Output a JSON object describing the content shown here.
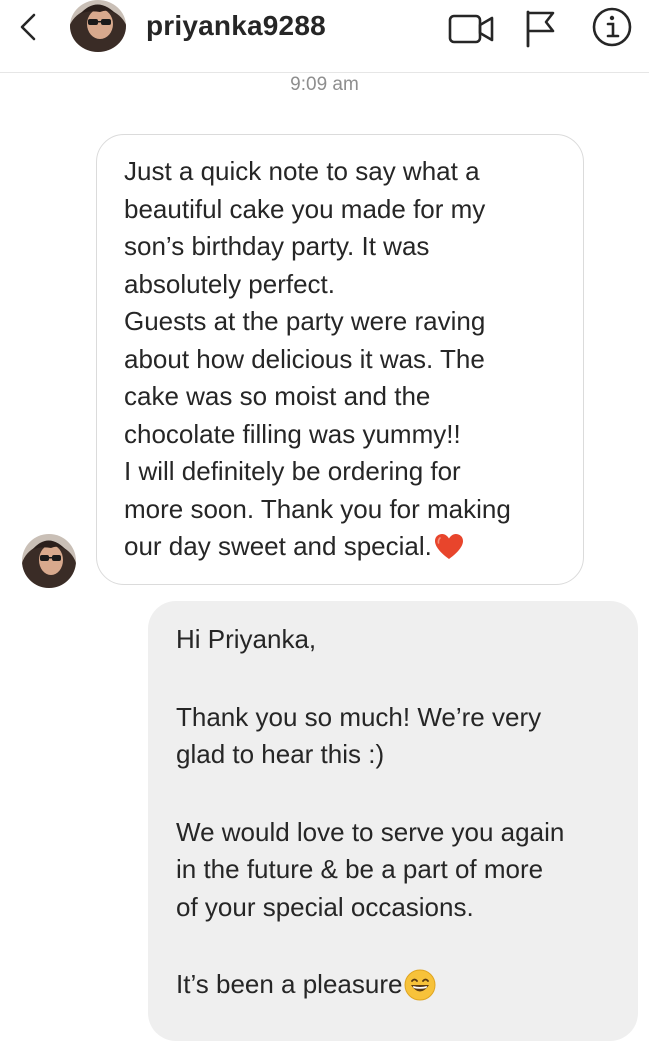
{
  "header": {
    "username": "priyanka9288",
    "icons": [
      "back-chevron-icon",
      "video-call-icon",
      "flag-report-icon",
      "info-icon"
    ]
  },
  "thread": {
    "timestamp": "9:09 am",
    "incoming": {
      "lines": [
        "Just a quick note to say what a\nbeautiful cake you made for my\nson’s birthday party. It was\nabsolutely perfect.",
        "Guests at the party were raving\nabout how delicious it was. The\ncake was so moist and the\nchocolate filling was yummy!!",
        "I will definitely be ordering for\nmore soon. Thank you for making\nour day sweet and special."
      ],
      "end_emoji": "red-heart"
    },
    "outgoing": {
      "paragraphs": [
        "Hi Priyanka,",
        "Thank you so much! We’re very\nglad to hear this :)",
        "We would love to serve you again\nin the future & be a part of more\nof your special occasions.",
        "It’s been a pleasure"
      ],
      "end_emoji": "grinning-face"
    }
  },
  "colors": {
    "text": "#262626",
    "muted": "#8e8e8e",
    "incoming_border": "#dbdbdb",
    "outgoing_bg": "#efefef",
    "heart": "#e8452c",
    "smiley": "#f7c23a"
  }
}
